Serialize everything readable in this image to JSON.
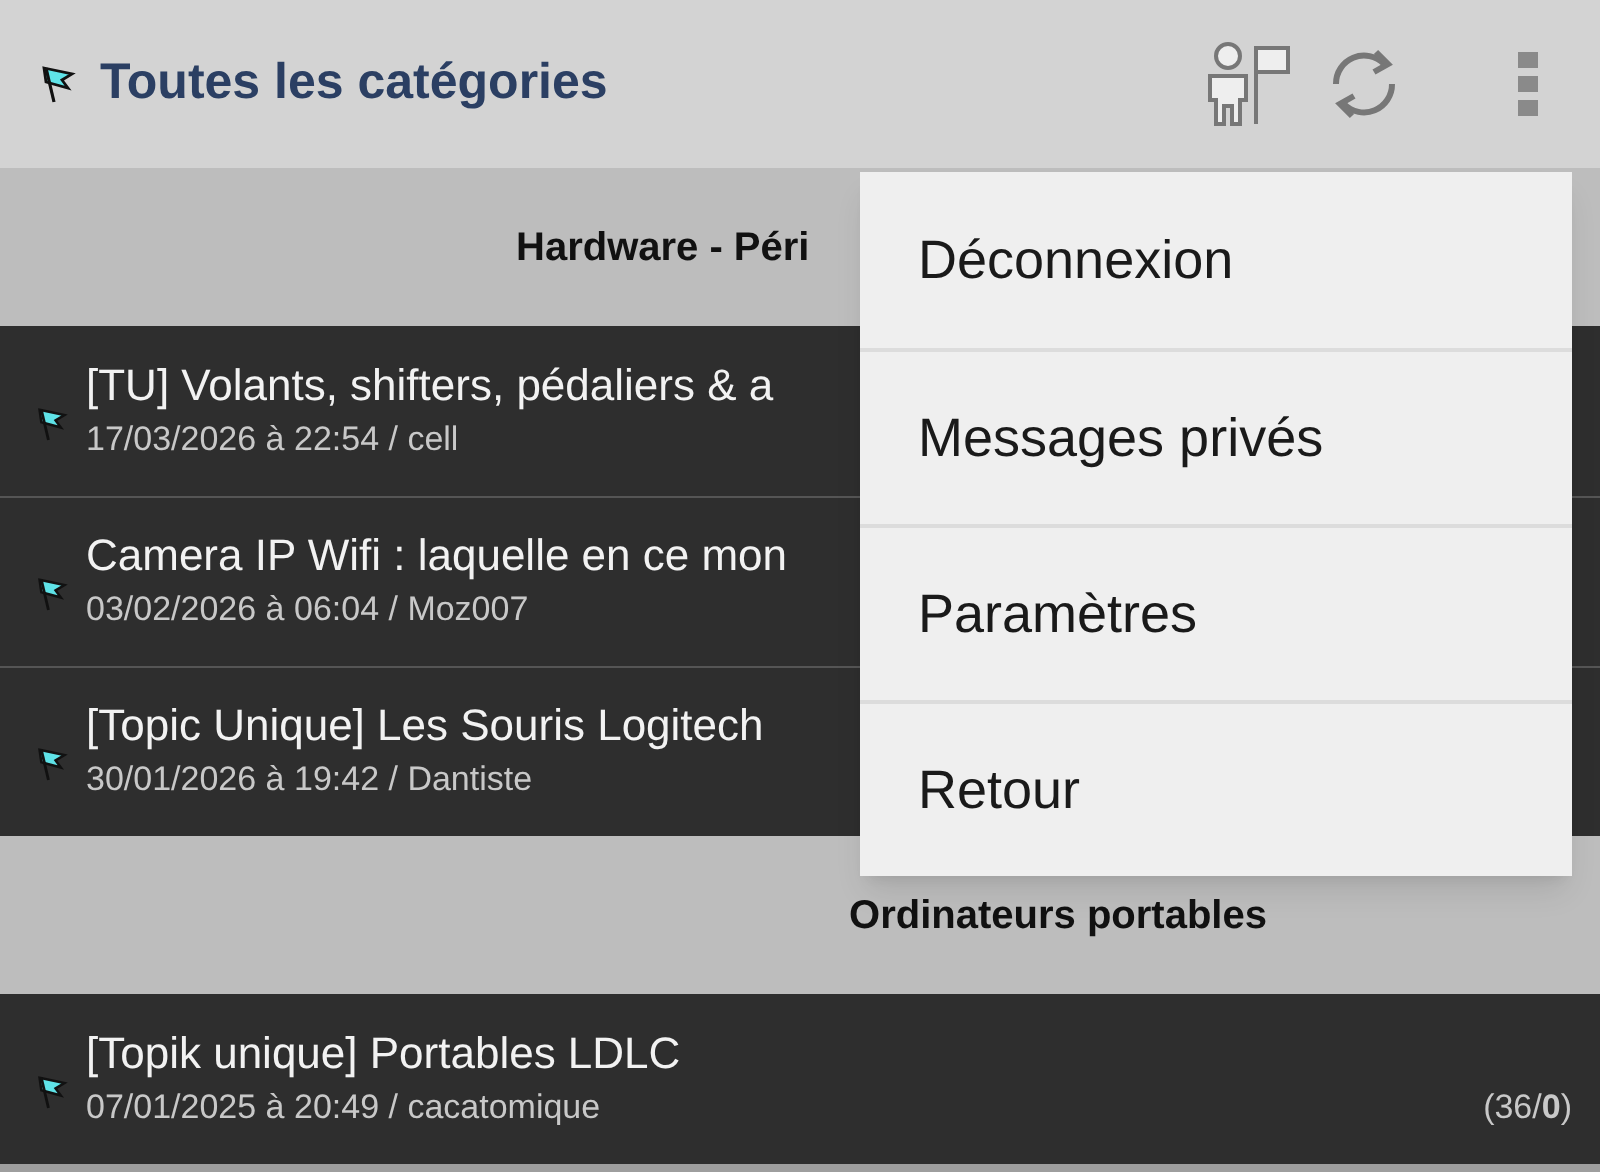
{
  "app_bar": {
    "title": "Toutes les catégories"
  },
  "sections": [
    {
      "title": "Hardware - Péri",
      "topics": [
        {
          "title": "[TU] Volants, shifters, pédaliers & a",
          "meta": "17/03/2026 à 22:54 / cell"
        },
        {
          "title": "Camera IP Wifi : laquelle en ce mon",
          "meta": "03/02/2026 à 06:04 / Moz007"
        },
        {
          "title": "[Topic Unique] Les Souris Logitech",
          "meta": "30/01/2026 à 19:42 / Dantiste"
        }
      ]
    },
    {
      "title": "Ordinateurs portables",
      "topics": [
        {
          "title": "[Topik unique] Portables LDLC",
          "meta": "07/01/2025 à 20:49 / cacatomique",
          "count": "(36/**0**)"
        }
      ]
    }
  ],
  "menu": {
    "items": [
      "Déconnexion",
      "Messages privés",
      "Paramètres",
      "Retour"
    ]
  }
}
